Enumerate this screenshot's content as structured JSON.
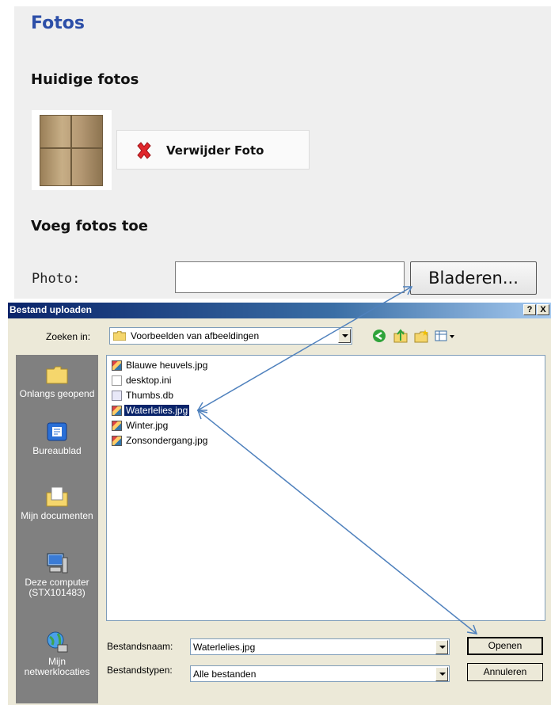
{
  "webpage": {
    "title": "Fotos",
    "current_heading": "Huidige fotos",
    "delete_button_label": "Verwijder Foto",
    "add_heading": "Voeg fotos toe",
    "photo_label": "Photo:",
    "file_input_value": "",
    "browse_button_label": "Bladeren..."
  },
  "dialog": {
    "title": "Bestand uploaden",
    "help_label": "?",
    "close_label": "X",
    "look_in_label": "Zoeken in:",
    "look_in_value": "Voorbeelden van afbeeldingen",
    "places": [
      {
        "label": "Onlangs geopend",
        "icon": "recent-folder-icon"
      },
      {
        "label": "Bureaublad",
        "icon": "desktop-icon"
      },
      {
        "label": "Mijn documenten",
        "icon": "my-documents-icon"
      },
      {
        "label": "Deze computer (STX101483)",
        "icon": "computer-icon"
      },
      {
        "label": "Mijn netwerklocaties",
        "icon": "network-icon"
      }
    ],
    "files": [
      {
        "name": "Blauwe heuvels.jpg",
        "type": "jpg",
        "selected": false
      },
      {
        "name": "desktop.ini",
        "type": "ini",
        "selected": false
      },
      {
        "name": "Thumbs.db",
        "type": "db",
        "selected": false
      },
      {
        "name": "Waterlelies.jpg",
        "type": "jpg",
        "selected": true
      },
      {
        "name": "Winter.jpg",
        "type": "jpg",
        "selected": false
      },
      {
        "name": "Zonsondergang.jpg",
        "type": "jpg",
        "selected": false
      }
    ],
    "filename_label": "Bestandsnaam:",
    "filename_value": "Waterlelies.jpg",
    "filetype_label": "Bestandstypen:",
    "filetype_value": "Alle bestanden",
    "open_button_label": "Openen",
    "cancel_button_label": "Annuleren"
  },
  "colors": {
    "page_title": "#2d4fa8",
    "annotation_arrow": "#4f81bd",
    "selection": "#0a246a",
    "dialog_face": "#ece9d8"
  }
}
